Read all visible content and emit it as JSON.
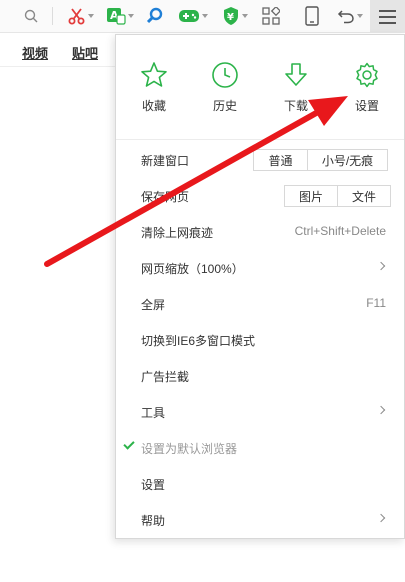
{
  "nav": {
    "video": "视频",
    "tieba": "贴吧"
  },
  "quick": [
    {
      "label": "收藏",
      "icon": "star-icon"
    },
    {
      "label": "历史",
      "icon": "clock-icon"
    },
    {
      "label": "下载",
      "icon": "download-icon"
    },
    {
      "label": "设置",
      "icon": "gear-icon"
    }
  ],
  "menu": {
    "new_window": {
      "label": "新建窗口",
      "normal": "普通",
      "incognito": "小号/无痕"
    },
    "save_page": {
      "label": "保存网页",
      "image": "图片",
      "file": "文件"
    },
    "clear_traces": {
      "label": "清除上网痕迹",
      "shortcut": "Ctrl+Shift+Delete"
    },
    "zoom": {
      "label": "网页缩放（100%）"
    },
    "fullscreen": {
      "label": "全屏",
      "shortcut": "F11"
    },
    "ie6_mode": {
      "label": "切换到IE6多窗口模式"
    },
    "adblock": {
      "label": "广告拦截"
    },
    "tools": {
      "label": "工具"
    },
    "default_browser": {
      "label": "设置为默认浏览器"
    },
    "settings": {
      "label": "设置"
    },
    "help": {
      "label": "帮助"
    }
  },
  "colors": {
    "accent": "#2cb34a",
    "arrow": "#e8181c"
  }
}
